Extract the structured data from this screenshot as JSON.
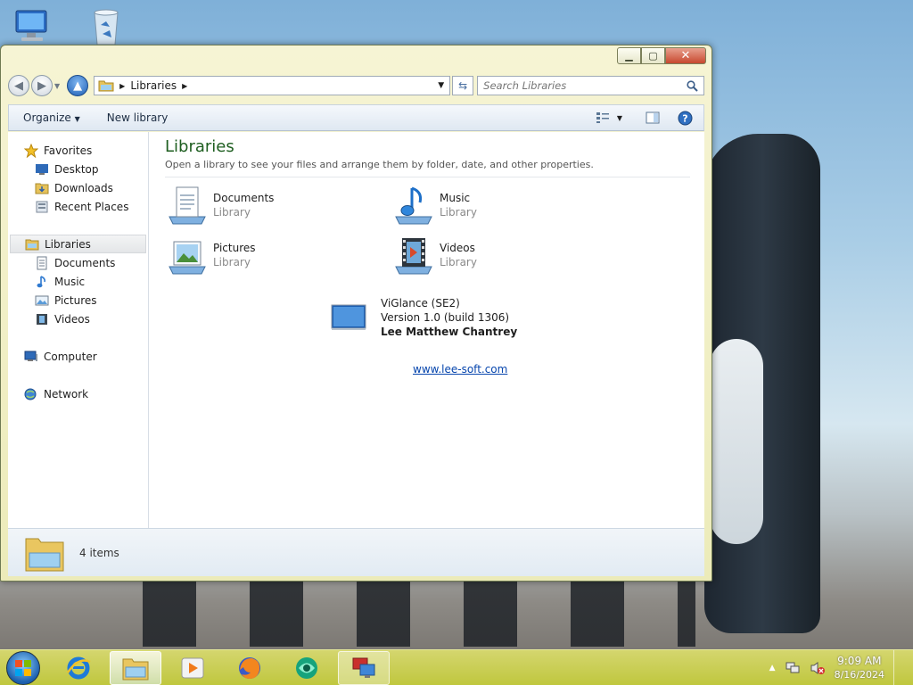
{
  "window": {
    "address": {
      "crumb": "Libraries"
    },
    "search": {
      "placeholder": "Search Libraries"
    },
    "toolbar": {
      "organize": "Organize",
      "new_library": "New library"
    },
    "nav": {
      "favorites": "Favorites",
      "favorites_items": [
        "Desktop",
        "Downloads",
        "Recent Places"
      ],
      "libraries": "Libraries",
      "libraries_items": [
        "Documents",
        "Music",
        "Pictures",
        "Videos"
      ],
      "computer": "Computer",
      "network": "Network"
    },
    "main": {
      "title": "Libraries",
      "description": "Open a library to see your files and arrange them by folder, date, and other properties.",
      "libraries": [
        {
          "name": "Documents",
          "type": "Library",
          "icon": "documents-icon"
        },
        {
          "name": "Music",
          "type": "Library",
          "icon": "music-icon"
        },
        {
          "name": "Pictures",
          "type": "Library",
          "icon": "pictures-icon"
        },
        {
          "name": "Videos",
          "type": "Library",
          "icon": "videos-icon"
        }
      ],
      "about": {
        "product": "ViGlance (SE2)",
        "version": "Version 1.0 (build 1306)",
        "author": "Lee Matthew Chantrey",
        "link": "www.lee-soft.com"
      }
    },
    "details": {
      "count": "4 items"
    }
  },
  "taskbar": {
    "apps": [
      "internet-explorer-icon",
      "windows-explorer-icon",
      "media-player-icon",
      "firefox-icon",
      "app-icon",
      "remote-desktop-icon"
    ],
    "clock": {
      "time": "9:09 AM",
      "date": "8/16/2024"
    }
  },
  "colors": {
    "title_green": "#1e5e20",
    "link_blue": "#0645ad",
    "taskbar": "#c4cc3c"
  }
}
